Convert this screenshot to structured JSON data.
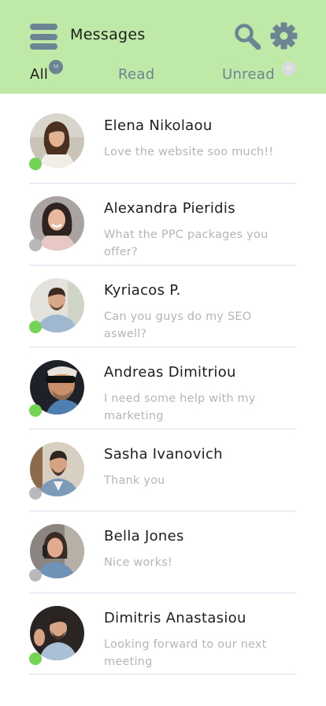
{
  "header": {
    "title": "Messages",
    "icons": {
      "menu": "hamburger-menu-icon",
      "search": "search-icon",
      "settings": "gear-icon"
    },
    "tabs": [
      {
        "label": "All",
        "badge": "10",
        "active": true
      },
      {
        "label": "Read",
        "active": false
      },
      {
        "label": "Unread",
        "badge": "10",
        "active": false
      }
    ]
  },
  "colors": {
    "header_bg": "#bfe9a6",
    "accent": "#6d8494",
    "online": "#74d455",
    "offline": "#b7b9bb",
    "divider": "#d7dcea",
    "preview_text": "#b5b5b5"
  },
  "conversations": [
    {
      "name": "Elena Nikolaou",
      "preview": "Love the website soo much!!",
      "status": "online"
    },
    {
      "name": "Alexandra Pieridis",
      "preview": "What the PPC packages you offer?",
      "status": "offline"
    },
    {
      "name": "Kyriacos P.",
      "preview": "Can you guys do my SEO aswell?",
      "status": "online"
    },
    {
      "name": "Andreas Dimitriou",
      "preview": "I need some help with my marketing",
      "status": "online"
    },
    {
      "name": "Sasha Ivanovich",
      "preview": "Thank you",
      "status": "offline"
    },
    {
      "name": "Bella Jones",
      "preview": "Nice works!",
      "status": "offline"
    },
    {
      "name": "Dimitris Anastasiou",
      "preview": "Looking forward to our next meeting",
      "status": "online"
    }
  ]
}
